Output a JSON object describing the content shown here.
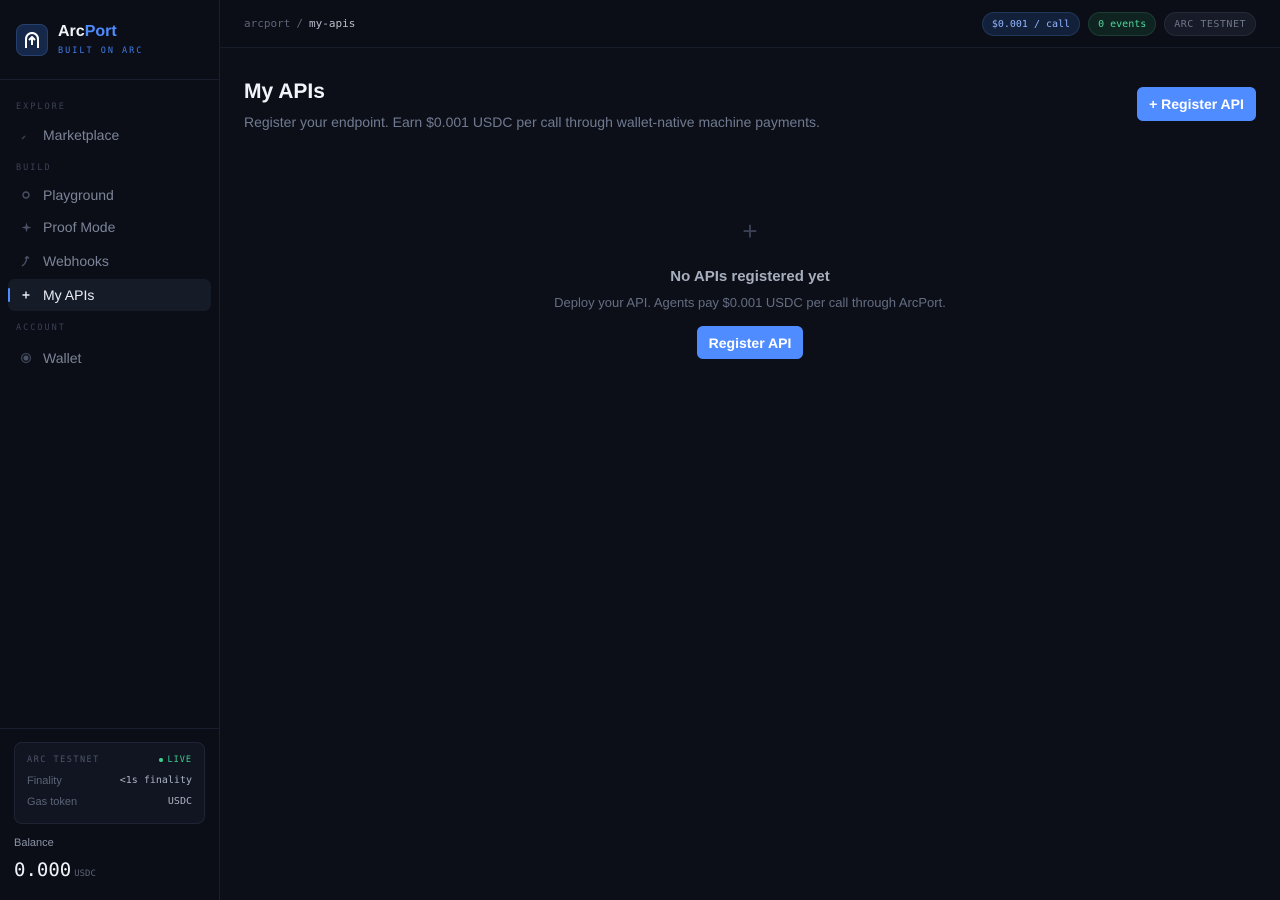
{
  "brand": {
    "name_part1": "Arc",
    "name_part2": "Port",
    "subtitle": "BUILT ON ARC"
  },
  "sidebar": {
    "sections": [
      {
        "label": "EXPLORE"
      },
      {
        "label": "BUILD"
      },
      {
        "label": "ACCOUNT"
      }
    ],
    "items": [
      {
        "label": "Marketplace",
        "icon": "check-icon"
      },
      {
        "label": "Playground",
        "icon": "circle-icon"
      },
      {
        "label": "Proof Mode",
        "icon": "sparkle-icon"
      },
      {
        "label": "Webhooks",
        "icon": "hook-icon"
      },
      {
        "label": "My APIs",
        "icon": "plus-icon",
        "active": true
      },
      {
        "label": "Wallet",
        "icon": "wallet-icon"
      }
    ],
    "network": {
      "title": "ARC TESTNET",
      "status": "LIVE",
      "rows": [
        {
          "key": "Finality",
          "value": "<1s finality"
        },
        {
          "key": "Gas token",
          "value": "USDC"
        }
      ]
    },
    "balance": {
      "label": "Balance",
      "value": "0.000",
      "unit": "USDC"
    }
  },
  "topbar": {
    "breadcrumb": {
      "root": "arcport",
      "separator": "/",
      "current": "my-apis"
    },
    "chips": {
      "price": "$0.001 / call",
      "events": "0 events",
      "network": "ARC TESTNET"
    }
  },
  "main": {
    "title": "My APIs",
    "subtitle": "Register your endpoint. Earn $0.001 USDC per call through wallet-native machine payments.",
    "header_button": "+ Register API",
    "empty": {
      "icon": "+",
      "title": "No APIs registered yet",
      "subtitle": "Deploy your API. Agents pay $0.001 USDC per call through ArcPort.",
      "button": "Register API"
    }
  },
  "colors": {
    "accent": "#4f8cff",
    "live": "#3ecf8e",
    "background": "#0c0f18"
  }
}
